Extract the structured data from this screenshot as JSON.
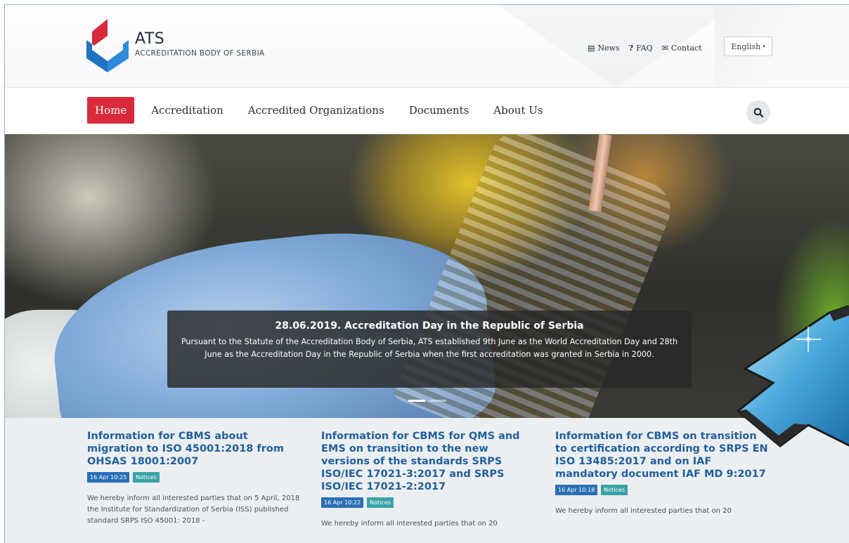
{
  "header": {
    "brand_name": "ATS",
    "brand_subtitle": "ACCREDITATION BODY OF SERBIA",
    "links": [
      {
        "icon": "newspaper-icon",
        "glyph": "▤",
        "label": "News"
      },
      {
        "icon": "question-icon",
        "glyph": "?",
        "label": "FAQ"
      },
      {
        "icon": "envelope-icon",
        "glyph": "✉",
        "label": "Contact"
      }
    ],
    "language": "English"
  },
  "nav": {
    "items": [
      {
        "label": "Home",
        "active": true
      },
      {
        "label": "Accreditation",
        "active": false
      },
      {
        "label": "Accredited Organizations",
        "active": false
      },
      {
        "label": "Documents",
        "active": false
      },
      {
        "label": "About Us",
        "active": false
      }
    ]
  },
  "hero": {
    "title": "28.06.2019. Accreditation Day in the Republic of Serbia",
    "text": "Pursuant to the Statute of the Accreditation Body of Serbia, ATS established 9th June as the World Accreditation Day and 28th June as the Accreditation Day in the Republic of Serbia when the first accreditation was granted in Serbia in 2000.",
    "slides": 2,
    "active_slide": 1
  },
  "news": [
    {
      "title": "Information for CBMS about migration to ISO 45001:2018 from OHSAS 18001:2007",
      "date": "16 Apr 10:25",
      "category": "Notices",
      "excerpt": "We hereby inform all interested parties that on 5 April, 2018 the Institute for Standardization of Serbia (ISS) published standard SRPS ISO 45001: 2018 -"
    },
    {
      "title": "Information for CBMS for QMS and EMS on transition to the new versions of the standards SRPS ISO/IEC 17021-3:2017 and SRPS ISO/IEC 17021-2:2017",
      "date": "16 Apr 10:22",
      "category": "Notices",
      "excerpt": "We hereby inform all interested parties that on 20"
    },
    {
      "title": "Information for CBMS on transition to certification according to SRPS EN ISO 13485:2017 and on IAF mandatory document IAF MD 9:2017",
      "date": "16 Apr 10:18",
      "category": "Notices",
      "excerpt": "We hereby inform all interested parties that on 20"
    }
  ],
  "colors": {
    "accent_red": "#d82a3b",
    "link_blue": "#1f5f9c",
    "date_tag": "#2a6fb5",
    "category_tag": "#3aa3a8"
  }
}
